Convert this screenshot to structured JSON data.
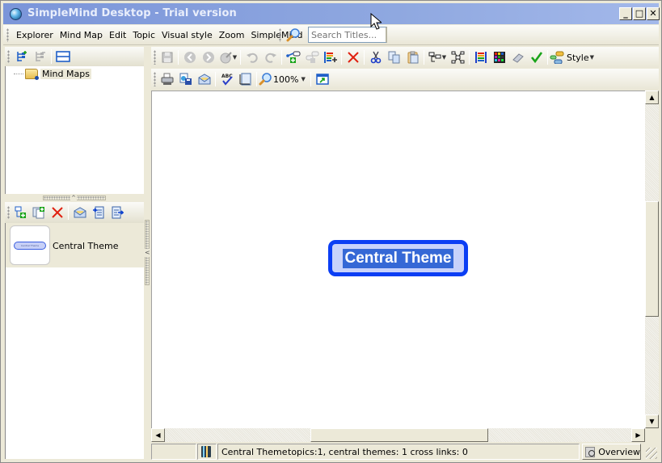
{
  "window": {
    "title": "SimpleMind Desktop - Trial version",
    "controls": {
      "minimize": "_",
      "maximize": "□",
      "close": "✕"
    }
  },
  "menubar": {
    "items": [
      "Explorer",
      "Mind Map",
      "Edit",
      "Topic",
      "Visual style",
      "Zoom",
      "SimpleMind"
    ],
    "search_placeholder": "Search Titles..."
  },
  "explorer": {
    "toolbar": [
      "add-folder-icon",
      "remove-folder-icon",
      "layout-toggle-icon"
    ],
    "tree": [
      {
        "label": "Mind Maps",
        "icon": "folder-icon"
      }
    ],
    "splitter_arrow": "^"
  },
  "maps_panel": {
    "toolbar": [
      "new-mindmap-icon",
      "duplicate-mindmap-icon",
      "delete-icon",
      "email-icon",
      "import-icon",
      "export-icon"
    ],
    "items": [
      {
        "label": "Central Theme",
        "thumb_text": "Central Theme"
      }
    ],
    "splitter_arrow": "<"
  },
  "main_toolbar": {
    "row1": [
      "save-icon",
      "back-icon",
      "forward-icon",
      "palette-icon",
      "undo-icon",
      "redo-icon",
      "add-child-topic-icon",
      "add-sibling-topic-icon",
      "add-list-icon",
      "delete-icon",
      "cut-icon",
      "copy-icon",
      "paste-icon",
      "layout-icon",
      "structure-icon",
      "color-bars-icon",
      "color-grid-icon",
      "eraser-icon",
      "checkmark-icon",
      "style-icon"
    ],
    "style_label": "Style",
    "row2": [
      "print-icon",
      "save-image-icon",
      "email-icon",
      "spellcheck-icon",
      "page-setup-icon",
      "zoom-icon",
      "fullscreen-icon"
    ],
    "zoom_level": "100%"
  },
  "canvas": {
    "central_topic": "Central Theme",
    "colors": {
      "node_border": "#0b3ef4",
      "node_fill": "#c8d2fb",
      "selection": "#3568d6"
    }
  },
  "scrollbars": {
    "up": "▲",
    "down": "▼",
    "left": "◀",
    "right": "▶"
  },
  "statusbar": {
    "selected_topic": "Central Theme",
    "stats": "topics:1, central themes: 1 cross links: 0",
    "overview_label": "Overview"
  }
}
